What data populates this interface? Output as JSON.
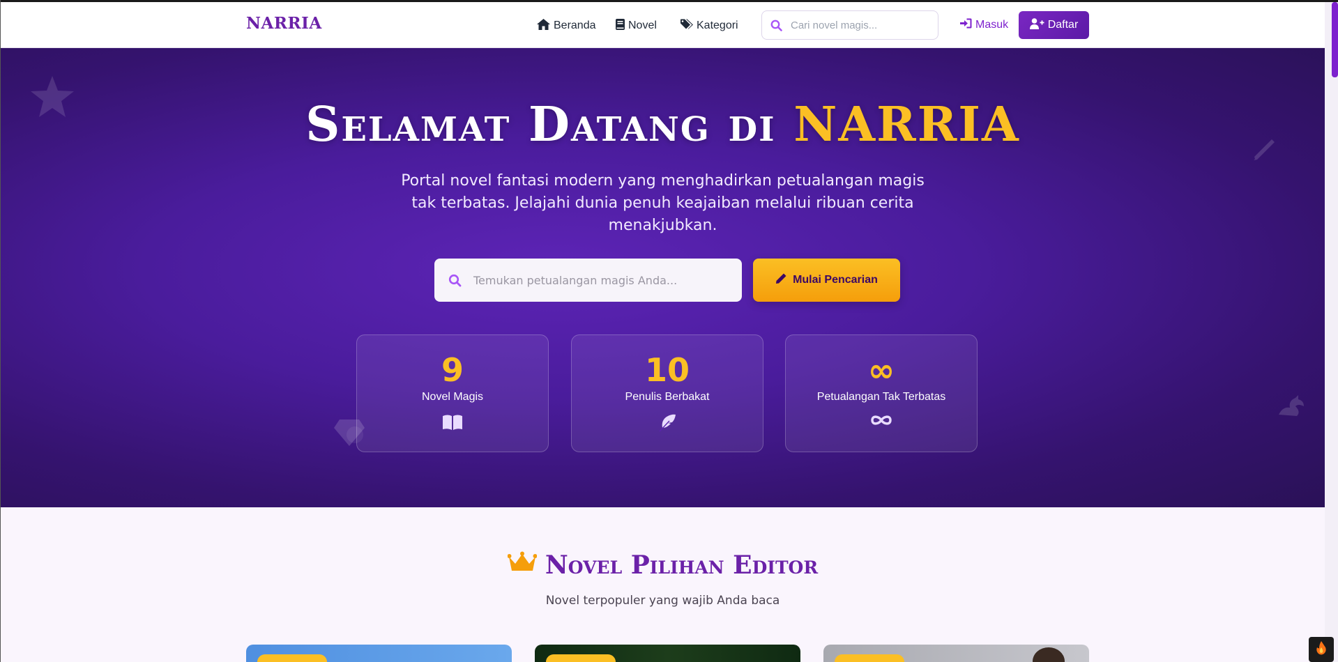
{
  "navbar": {
    "brand": "NARRIA",
    "links": [
      {
        "label": "Beranda",
        "icon": "home-icon"
      },
      {
        "label": "Novel",
        "icon": "book-icon"
      },
      {
        "label": "Kategori",
        "icon": "tags-icon"
      }
    ],
    "search_placeholder": "Cari novel magis...",
    "login_label": "Masuk",
    "register_label": "Daftar"
  },
  "hero": {
    "title_prefix": "Selamat Datang di ",
    "title_accent": "NARRIA",
    "subtitle": "Portal novel fantasi modern yang menghadirkan petualangan magis tak terbatas. Jelajahi dunia penuh keajaiban melalui ribuan cerita menakjubkan.",
    "search_placeholder": "Temukan petualangan magis Anda...",
    "cta_label": "Mulai Pencarian",
    "stats": [
      {
        "value": "9",
        "label": "Novel Magis",
        "icon": "book-open-icon"
      },
      {
        "value": "10",
        "label": "Penulis Berbakat",
        "icon": "feather-icon"
      },
      {
        "value": "∞",
        "label": "Petualangan Tak Terbatas",
        "icon": "infinity-icon"
      }
    ]
  },
  "featured": {
    "title": "Novel Pilihan Editor",
    "title_icon": "crown-icon",
    "subtitle": "Novel terpopuler yang wajib Anda baca"
  },
  "colors": {
    "primary": "#6b21a8",
    "accent": "#fbbf24",
    "hero_bg": "#4a1c9c"
  }
}
